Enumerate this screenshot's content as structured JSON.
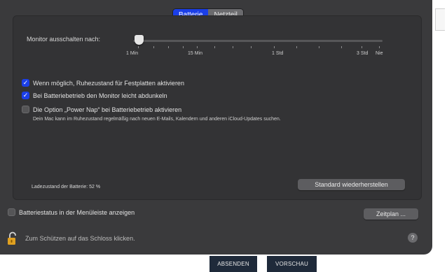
{
  "tabs": [
    {
      "label": "Batterie",
      "active": true
    },
    {
      "label": "Netzteil",
      "active": false
    }
  ],
  "slider": {
    "label": "Monitor ausschalten nach:",
    "value_label": "1 Min",
    "ticks": [
      "1 Min",
      "15 Min",
      "1 Std",
      "3 Std",
      "Nie"
    ]
  },
  "options": [
    {
      "label": "Wenn möglich, Ruhezustand für Festplatten aktivieren",
      "checked": true
    },
    {
      "label": "Bei Batteriebetrieb den Monitor leicht abdunkeln",
      "checked": true
    },
    {
      "label": "Die Option „Power Nap“ bei Batteriebetrieb aktivieren",
      "checked": false
    }
  ],
  "power_nap_note": "Dein Mac kann im Ruhezustand regelmäßig nach neuen E-Mails, Kalendern und anderen iCloud-Updates suchen.",
  "battery_level": "Ladezustand der Batterie: 52 %",
  "buttons": {
    "restore_defaults": "Standard wiederherstellen",
    "schedule": "Zeitplan ..."
  },
  "menubar_option": {
    "label": "Batteriestatus in der Menüleiste anzeigen",
    "checked": false
  },
  "lock_text": "Zum Schützen auf das Schloss klicken.",
  "help_symbol": "?",
  "background_buttons": [
    "ABSENDEN",
    "VORSCHAU"
  ],
  "colors": {
    "accent": "#1b3fe8",
    "window_bg": "#3a3a3c",
    "panel_bg": "#333335",
    "lock": "#e0a020",
    "background_button": "#1f2a3a"
  },
  "icons": {
    "lock": "lock-open-icon",
    "help": "help-icon",
    "check": "checkmark-icon"
  }
}
